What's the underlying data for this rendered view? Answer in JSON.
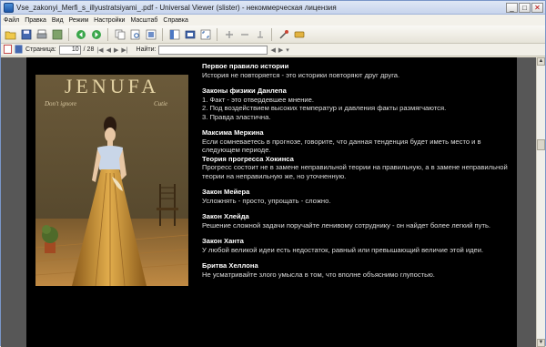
{
  "window": {
    "title": "Vse_zakonyi_Merfi_s_illyustratsiyami_.pdf - Universal Viewer (slister) - некоммерческая лицензия",
    "buttons": [
      "_",
      "□",
      "✕"
    ]
  },
  "menu": [
    "Файл",
    "Правка",
    "Вид",
    "Режим",
    "Настройки",
    "Масштаб",
    "Справка"
  ],
  "nav": {
    "page_label": "Страница:",
    "page_value": "10",
    "page_total": "/ 28",
    "find_label": "Найти:",
    "find_value": ""
  },
  "picture": {
    "header": "JENUFA",
    "caption_left": "Don't ignore",
    "caption_right": "Cutie"
  },
  "laws": [
    {
      "title": "Первое правило истории",
      "body": "История не повторяется - это историки повторяют друг друга."
    },
    {
      "title": "Законы физики Данлепа",
      "body": "1. Факт - это отвердевшее мнение.\n2. Под воздействием высоких температур и давления факты размягчаются.\n3. Правда эластична."
    },
    {
      "title": "Максима Меркина",
      "body": "Если сомневаетесь в прогнозе, говорите, что данная тенденция будет иметь место и в следующем периоде."
    },
    {
      "title": "Теория прогресса Хокинса",
      "body": "Прогресс состоит не в замене неправильной теории на правильную, а в замене неправильной теории на неправильную же, но уточненную."
    },
    {
      "title": "Закон Мейера",
      "body": "Усложнять - просто, упрощать - сложно."
    },
    {
      "title": "Закон Хлейда",
      "body": "Решение сложной задачи поручайте ленивому сотруднику - он найдет более легкий путь."
    },
    {
      "title": "Закон Ханта",
      "body": "У любой великой идеи есть недостаток, равный или превышающий величие этой идеи."
    },
    {
      "title": "Бритва Хеллона",
      "body": "Не усматривайте злого умысла в том, что вполне объяснимо глупостью."
    }
  ],
  "icons": [
    "open-icon",
    "save-icon",
    "print-icon",
    "refresh-icon",
    "back-icon",
    "forward-icon",
    "copy-icon",
    "find-icon",
    "fit-width-icon",
    "fit-page-icon",
    "fullscreen-icon",
    "zoom-in-icon",
    "zoom-out-icon",
    "rotate-icon",
    "settings-icon",
    "bookmark-icon"
  ]
}
